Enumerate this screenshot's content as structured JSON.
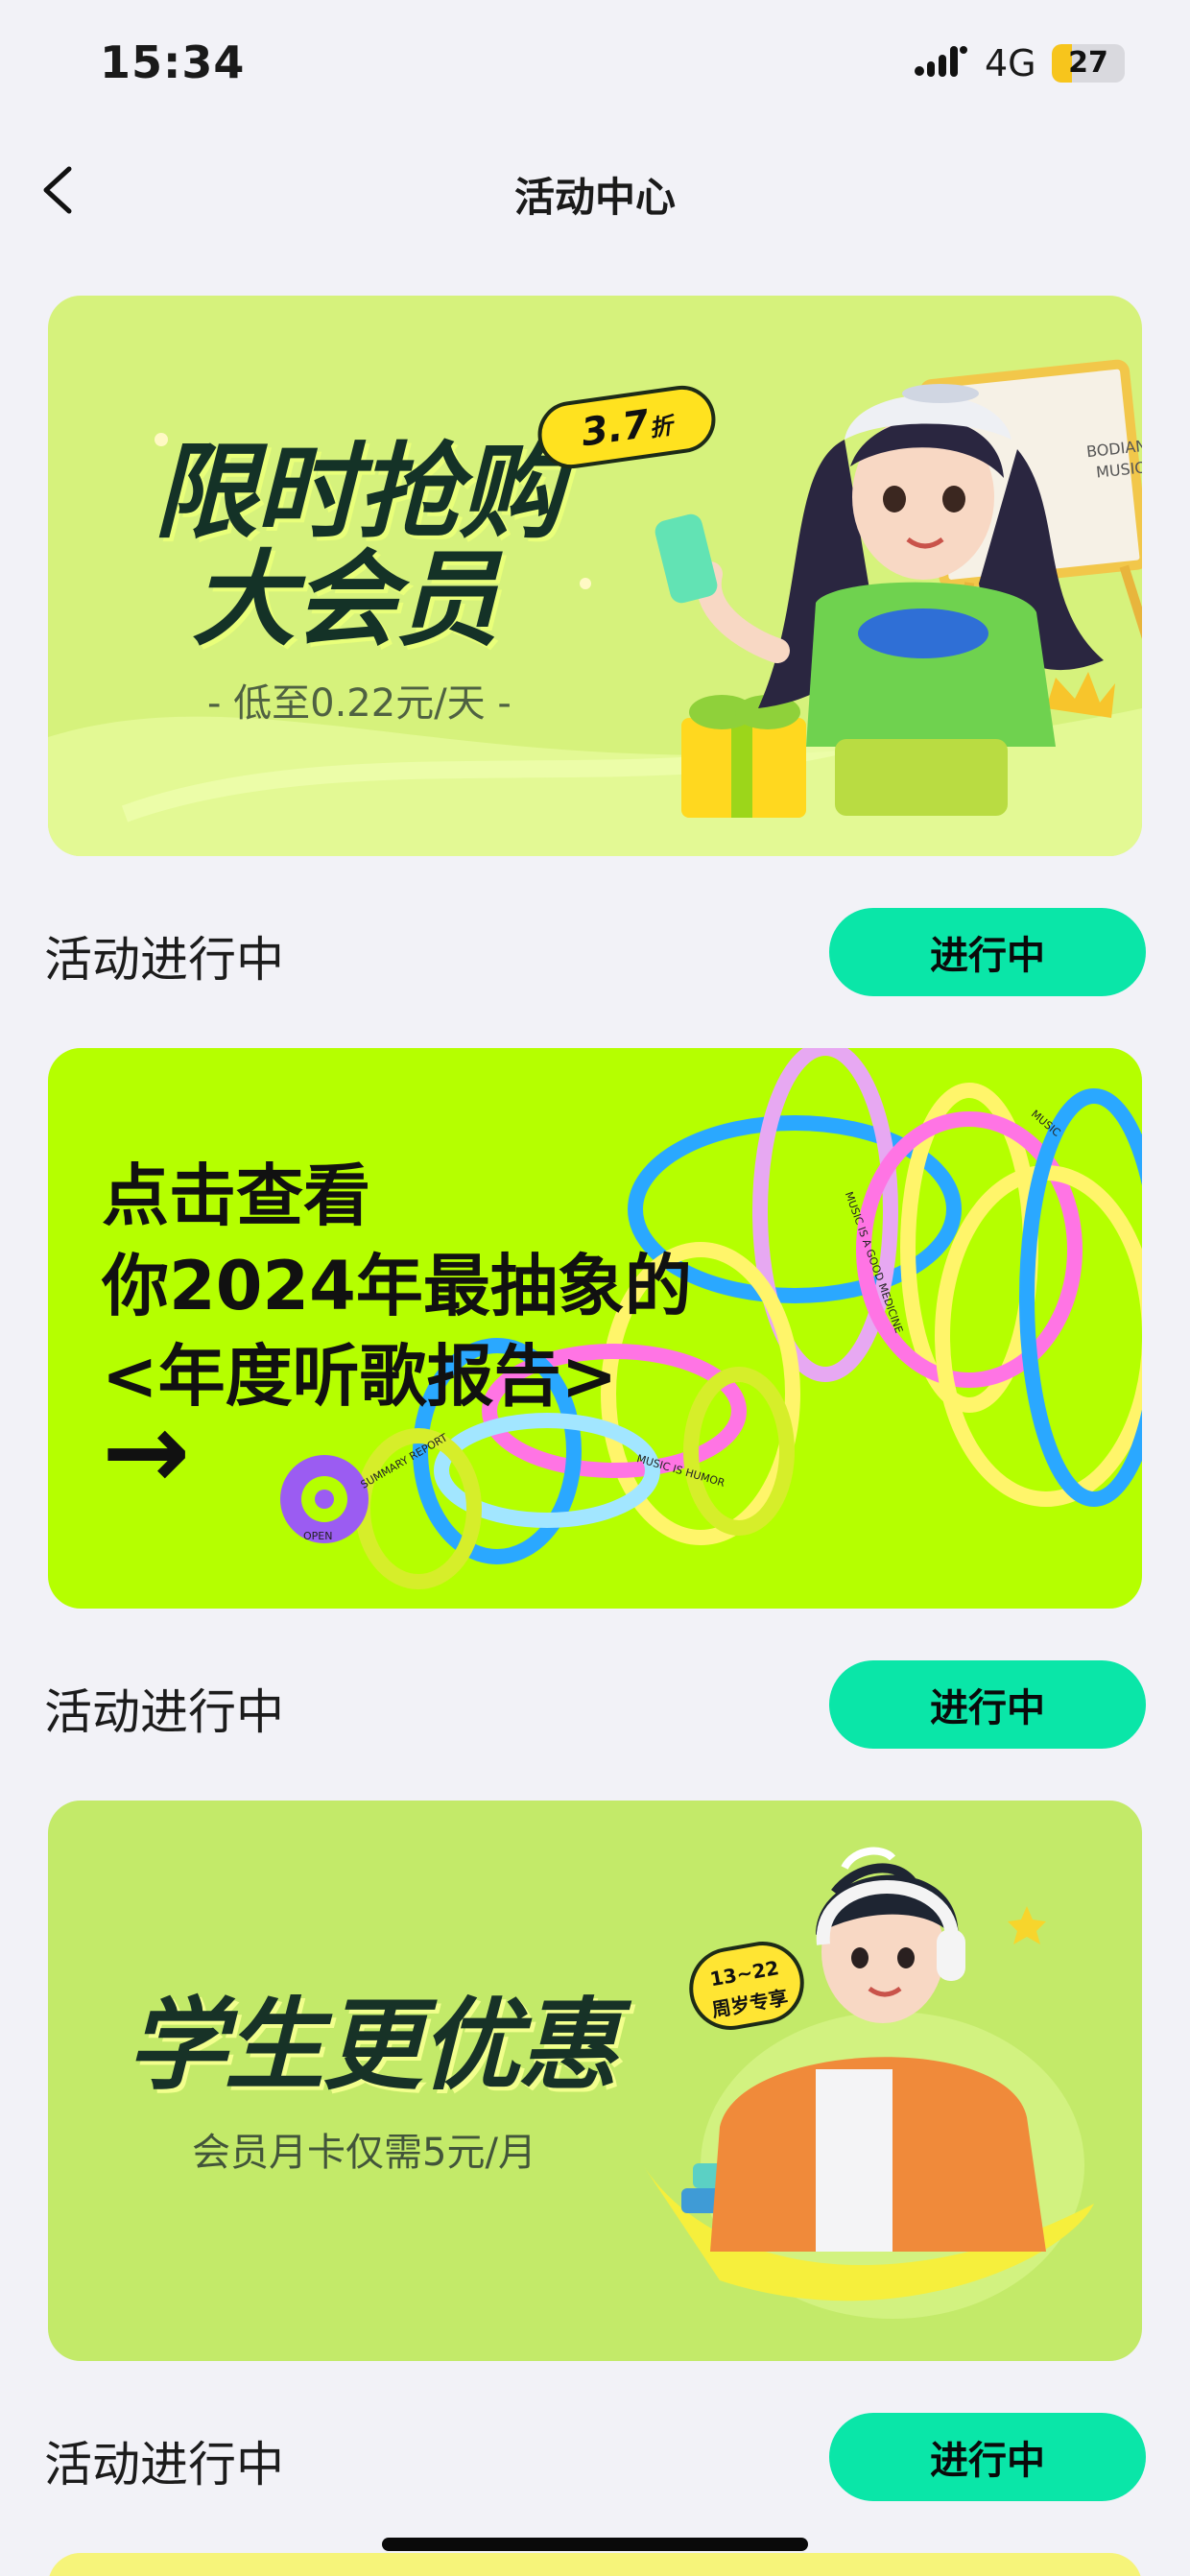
{
  "status_bar": {
    "time": "15:34",
    "network": "4G",
    "battery_level": "27",
    "battery_fraction": 0.27,
    "icons": [
      "signal-icon",
      "battery-icon"
    ]
  },
  "nav": {
    "title": "活动中心",
    "back_icon": "chevron-left-icon"
  },
  "colors": {
    "background": "#f2f2f7",
    "status_button": "#0ae6a8",
    "banner1_bg": "#d6f27c",
    "banner2_bg": "#b5ff00",
    "banner3_bg": "#c3ea69"
  },
  "activities": [
    {
      "banner": {
        "title_line1": "限时抢购",
        "title_line2": "大会员",
        "subtitle": "- 低至0.22元/天 -",
        "badge_value": "3.7",
        "badge_unit": "折",
        "board_text_1": "BODIAN",
        "board_text_2": "MUSIC"
      },
      "status_label": "活动进行中",
      "button_label": "进行中"
    },
    {
      "banner": {
        "line1": "点击查看",
        "line2": "你2024年最抽象的",
        "line3": "<年度听歌报告>",
        "arrow": "→",
        "ring_text_1": "SUMMARY REPORT",
        "ring_text_2": "OPEN",
        "ring_text_3": "MUSIC IS HUMOR",
        "ring_text_4": "MUSIC IS A GOOD MEDICINE",
        "ring_text_5": "MUSIC"
      },
      "status_label": "活动进行中",
      "button_label": "进行中"
    },
    {
      "banner": {
        "title": "学生更优惠",
        "subtitle": "会员月卡仅需5元/月",
        "badge_line1": "13~22",
        "badge_line2": "周岁专享"
      },
      "status_label": "活动进行中",
      "button_label": "进行中"
    }
  ]
}
